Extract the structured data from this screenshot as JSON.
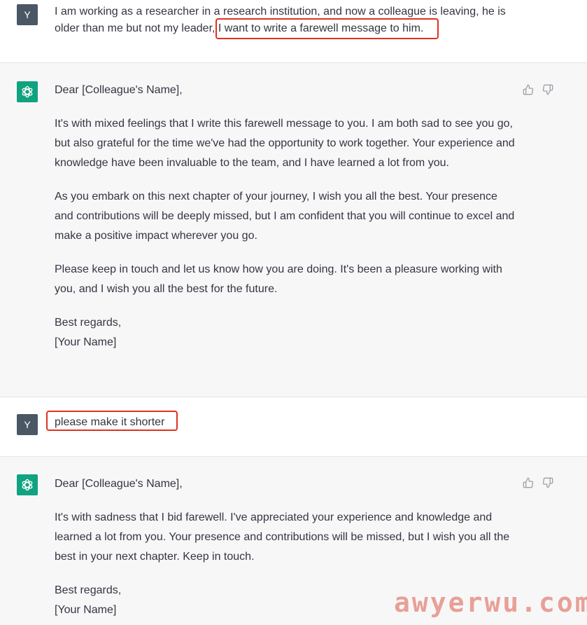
{
  "conversation": {
    "turns": [
      {
        "role": "user",
        "avatar_letter": "Y",
        "text": "I am working as a researcher in a research institution, and now a colleague is leaving, he is older than me but not my leader, I want to write a farewell message to him."
      },
      {
        "role": "assistant",
        "paragraphs": [
          "Dear [Colleague's Name],",
          "It's with mixed feelings that I write this farewell message to you. I am both sad to see you go, but also grateful for the time we've had the opportunity to work together. Your experience and knowledge have been invaluable to the team, and I have learned a lot from you.",
          "As you embark on this next chapter of your journey, I wish you all the best. Your presence and contributions will be deeply missed, but I am confident that you will continue to excel and make a positive impact wherever you go.",
          "Please keep in touch and let us know how you are doing. It's been a pleasure working with you, and I wish you all the best for the future."
        ],
        "signoff_line1": "Best regards,",
        "signoff_line2": "[Your Name]"
      },
      {
        "role": "user",
        "avatar_letter": "Y",
        "text": "please make it shorter"
      },
      {
        "role": "assistant",
        "paragraphs": [
          "Dear [Colleague's Name],",
          "It's with sadness that I bid farewell. I've appreciated your experience and knowledge and learned a lot from you. Your presence and contributions will be missed, but I wish you all the best in your next chapter. Keep in touch."
        ],
        "signoff_line1": "Best regards,",
        "signoff_line2": "[Your Name]"
      }
    ]
  },
  "icons": {
    "thumbs_up": "thumbs-up-icon",
    "thumbs_down": "thumbs-down-icon",
    "assistant_logo": "openai-logo-icon"
  },
  "colors": {
    "assistant_bg": "#f7f7f8",
    "user_avatar_bg": "#4a5765",
    "assistant_avatar_bg": "#10a37f",
    "highlight_border": "#e0311f"
  },
  "watermark": "awyerwu.com"
}
